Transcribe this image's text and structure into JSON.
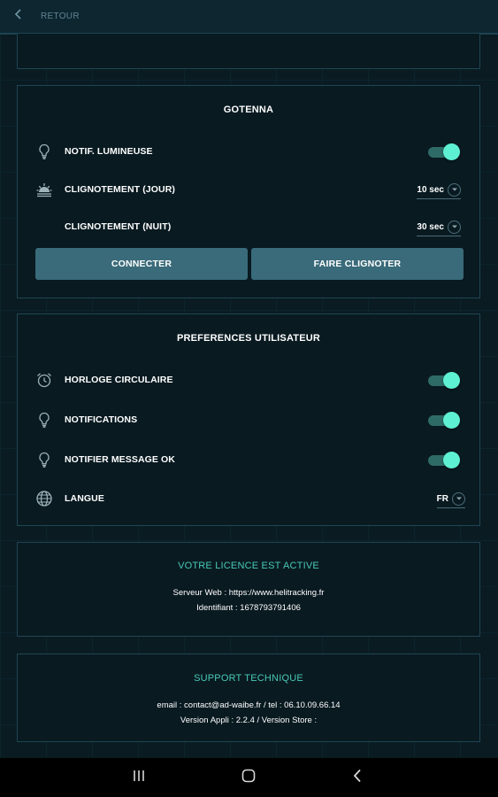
{
  "header": {
    "back_label": "RETOUR"
  },
  "gotenna": {
    "title": "GOTENNA",
    "notif_label": "NOTIF. LUMINEUSE",
    "notif_on": true,
    "day_label": "CLIGNOTEMENT (JOUR)",
    "day_value": "10 sec",
    "night_label": "CLIGNOTEMENT (NUIT)",
    "night_value": "30 sec",
    "connect_label": "CONNECTER",
    "blink_label": "FAIRE CLIGNOTER"
  },
  "prefs": {
    "title": "PREFERENCES UTILISATEUR",
    "clock_label": "HORLOGE CIRCULAIRE",
    "clock_on": true,
    "notifications_label": "NOTIFICATIONS",
    "notifications_on": true,
    "notify_ok_label": "NOTIFIER MESSAGE OK",
    "notify_ok_on": true,
    "language_label": "LANGUE",
    "language_value": "FR"
  },
  "license": {
    "title": "VOTRE LICENCE EST ACTIVE",
    "server_line": "Serveur Web : https://www.helitracking.fr",
    "id_line": "Identifiant : 1678793791406"
  },
  "support": {
    "title": "SUPPORT TECHNIQUE",
    "contact_line": "email : contact@ad-waibe.fr / tel : 06.10.09.66.14",
    "version_line": "Version Appli : 2.2.4 / Version Store :"
  },
  "colors": {
    "background": "#0a1b22",
    "panel_border": "#1f4553",
    "accent_teal": "#49c9b6",
    "toggle_knob": "#5ef0d2",
    "button": "#3a6b7a"
  },
  "icons": {
    "back": "chevron-left-icon",
    "lightbulb": "lightbulb-icon",
    "sunrise": "sunrise-icon",
    "moon": "moon-icon",
    "alarm_clock": "alarm-clock-icon",
    "globe": "globe-icon"
  }
}
